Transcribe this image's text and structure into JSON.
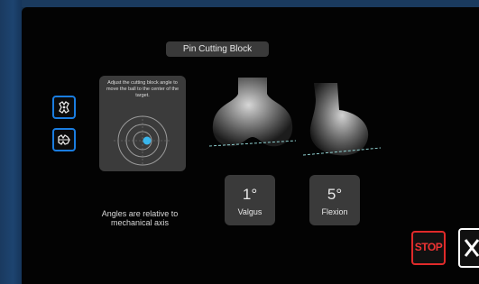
{
  "title": "Pin Cutting Block",
  "instructions": "Adjust the cutting block angle to move the ball to the center of the target.",
  "varus_valgus": {
    "value": "1°",
    "label": "Valgus"
  },
  "flexion": {
    "value": "5°",
    "label": "Flexion"
  },
  "note": "Angles are relative to mechanical axis",
  "stop_label": "STOP",
  "colors": {
    "accent": "#1a7de0",
    "stop": "#e02a2a",
    "target_ball": "#39b6ec"
  },
  "icons": [
    "bone-anterior-icon",
    "bone-lateral-icon",
    "close-icon"
  ]
}
